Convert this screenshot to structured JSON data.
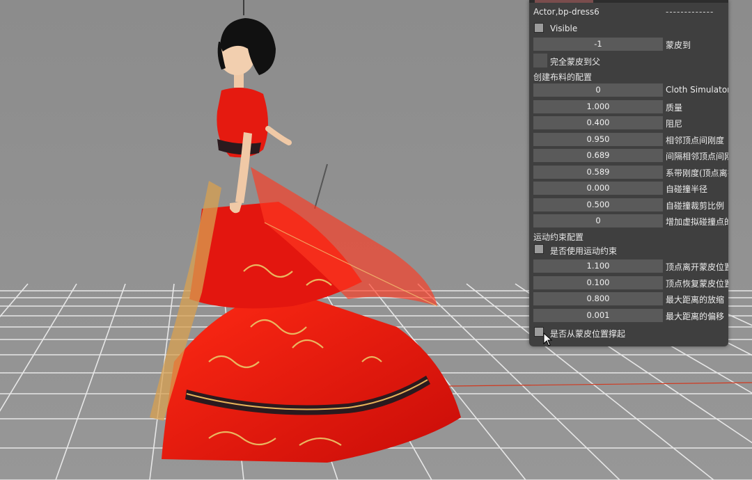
{
  "panel": {
    "title": "Actor,bp-dress6",
    "title_right": "-------------",
    "visible": {
      "label": "Visible",
      "checked": false
    },
    "skin_to": {
      "value": "-1",
      "label": "蒙皮到"
    },
    "full_skin_parent": {
      "label": "完全蒙皮到父"
    },
    "cloth_section_title": "创建布料的配置",
    "cloth_fields": [
      {
        "value": "0",
        "label": "Cloth Simulator"
      },
      {
        "value": "1.000",
        "label": "质量"
      },
      {
        "value": "0.400",
        "label": "阻尼"
      },
      {
        "value": "0.950",
        "label": "相邻顶点间刚度"
      },
      {
        "value": "0.689",
        "label": "间隔相邻顶点间刚"
      },
      {
        "value": "0.589",
        "label": "系带刚度(顶点离扌"
      },
      {
        "value": "0.000",
        "label": "自碰撞半径"
      },
      {
        "value": "0.500",
        "label": "自碰撞裁剪比例"
      },
      {
        "value": "0",
        "label": "增加虚拟碰撞点的"
      }
    ],
    "motion_section_title": "运动约束配置",
    "use_motion_constraint": {
      "label": "是否使用运动约束",
      "checked": false
    },
    "motion_fields": [
      {
        "value": "1.100",
        "label": "顶点离开蒙皮位置"
      },
      {
        "value": "0.100",
        "label": "顶点恢复蒙皮位置"
      },
      {
        "value": "0.800",
        "label": "最大距离的放缩"
      },
      {
        "value": "0.001",
        "label": "最大距离的偏移"
      }
    ],
    "lift_from_skin": {
      "label": "是否从蒙皮位置撑起",
      "checked": false
    }
  },
  "colors": {
    "viewport_bg": "#8f8f8f",
    "grid_line": "#e9e9e9",
    "panel_bg": "#3f3f3f",
    "field_bg": "#5a5a5a",
    "dress_red": "#e8140e",
    "gold_trim": "#e8b35a"
  }
}
